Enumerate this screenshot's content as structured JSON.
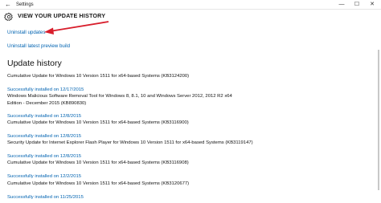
{
  "window": {
    "title": "Settings",
    "back_glyph": "←",
    "minimize_glyph": "—",
    "maximize_glyph": "☐",
    "close_glyph": "✕"
  },
  "header": {
    "icon": "gear-icon",
    "title": "VIEW YOUR UPDATE HISTORY"
  },
  "links": {
    "uninstall": "Uninstall updates",
    "preview": "Uninstall latest preview build"
  },
  "history": {
    "heading": "Update history",
    "items": [
      {
        "name": "Cumulative Update for Windows 10 Version 1511 for x64-based Systems (KB3124200)",
        "status": "Successfully installed on 12/17/2015"
      },
      {
        "name": "Windows Malicious Software Removal Tool for Windows 8, 8.1, 10 and Windows Server 2012, 2012 R2 x64 Edition - December 2015 (KB890830)",
        "status": "Successfully installed on 12/8/2015"
      },
      {
        "name": "Cumulative Update for Windows 10 Version 1511 for x64-based Systems (KB3116900)",
        "status": "Successfully installed on 12/8/2015"
      },
      {
        "name": "Security Update for Internet Explorer Flash Player for Windows 10 Version 1511 for x64-based Systems (KB3119147)",
        "status": "Successfully installed on 12/8/2015"
      },
      {
        "name": "Cumulative Update for Windows 10 Version 1511 for x64-based Systems (KB3116908)",
        "status": "Successfully installed on 12/2/2015"
      },
      {
        "name": "Cumulative Update for Windows 10 Version 1511 for x64-based Systems (KB3120677)",
        "status": "Successfully installed on 11/25/2015"
      }
    ]
  },
  "colors": {
    "link": "#0063b1",
    "annotation_arrow": "#d81e2c"
  }
}
